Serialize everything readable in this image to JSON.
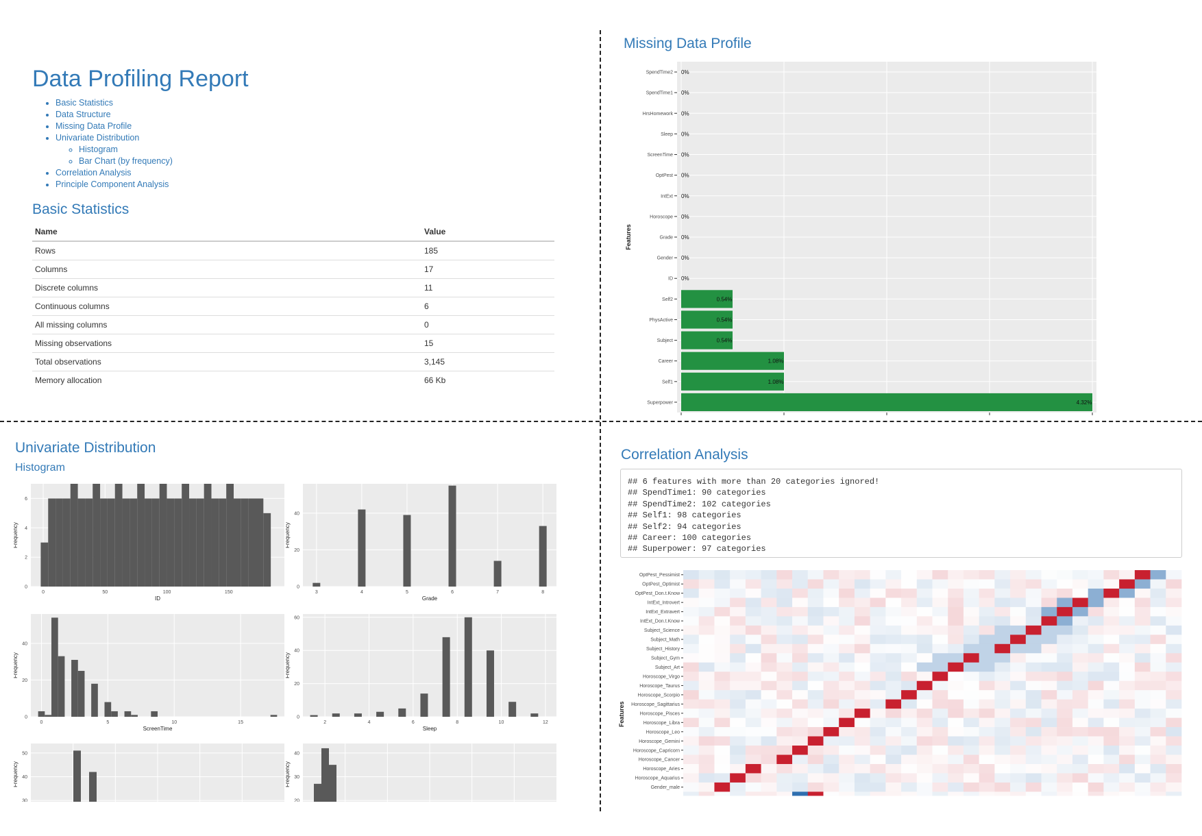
{
  "report": {
    "title": "Data Profiling Report",
    "toc": [
      {
        "label": "Basic Statistics"
      },
      {
        "label": "Data Structure"
      },
      {
        "label": "Missing Data Profile"
      },
      {
        "label": "Univariate Distribution",
        "children": [
          {
            "label": "Histogram"
          },
          {
            "label": "Bar Chart (by frequency)"
          }
        ]
      },
      {
        "label": "Correlation Analysis"
      },
      {
        "label": "Principle Component Analysis"
      }
    ]
  },
  "basic_statistics": {
    "heading": "Basic Statistics",
    "columns": [
      "Name",
      "Value"
    ],
    "rows": [
      [
        "Rows",
        "185"
      ],
      [
        "Columns",
        "17"
      ],
      [
        "Discrete columns",
        "11"
      ],
      [
        "Continuous columns",
        "6"
      ],
      [
        "All missing columns",
        "0"
      ],
      [
        "Missing observations",
        "15"
      ],
      [
        "Total observations",
        "3,145"
      ],
      [
        "Memory allocation",
        "66 Kb"
      ]
    ]
  },
  "missing": {
    "heading": "Missing Data Profile",
    "ylabel": "Features"
  },
  "univariate": {
    "heading": "Univariate Distribution",
    "subheading": "Histogram"
  },
  "correlation": {
    "heading": "Correlation Analysis",
    "ylabel": "Features",
    "console": [
      "## 6 features with more than 20 categories ignored!",
      "## SpendTime1: 90 categories",
      "## SpendTime2: 102 categories",
      "## Self1: 98 categories",
      "## Self2: 94 categories",
      "## Career: 100 categories",
      "## Superpower: 97 categories"
    ]
  },
  "colors": {
    "accent": "#337ab7",
    "bar_green": "#239142",
    "panel_bg": "#ebebeb",
    "hist_bar": "#595959",
    "cor_pos": "#c8202f",
    "cor_neg": "#2f6fb0"
  },
  "chart_data": [
    {
      "type": "bar",
      "orientation": "horizontal",
      "title": "Missing Data Profile",
      "ylabel": "Features",
      "categories": [
        "SpendTime2",
        "SpendTime1",
        "HrsHomework",
        "Sleep",
        "ScreenTime",
        "OptPest",
        "IntExt",
        "Horoscope",
        "Grade",
        "Gender",
        "ID",
        "Self2",
        "PhysActive",
        "Subject",
        "Career",
        "Self1",
        "Superpower"
      ],
      "values": [
        0,
        0,
        0,
        0,
        0,
        0,
        0,
        0,
        0,
        0,
        0,
        0.54,
        0.54,
        0.54,
        1.08,
        1.08,
        4.32
      ],
      "labels": [
        "0%",
        "0%",
        "0%",
        "0%",
        "0%",
        "0%",
        "0%",
        "0%",
        "0%",
        "0%",
        "0%",
        "0.54%",
        "0.54%",
        "0.54%",
        "1.08%",
        "1.08%",
        "4.32%"
      ],
      "xlim": [
        0,
        4.5
      ]
    },
    {
      "type": "bar",
      "title": "",
      "xlabel": "ID",
      "ylabel": "Frequency",
      "x": [
        1,
        7,
        13,
        19,
        25,
        31,
        37,
        43,
        49,
        55,
        61,
        67,
        73,
        79,
        85,
        91,
        97,
        103,
        109,
        115,
        121,
        127,
        133,
        139,
        145,
        151,
        157,
        163,
        169,
        175,
        181
      ],
      "values": [
        3,
        6,
        6,
        6,
        7,
        6,
        6,
        7,
        6,
        6,
        7,
        6,
        6,
        7,
        6,
        6,
        7,
        6,
        6,
        7,
        6,
        6,
        7,
        6,
        6,
        7,
        6,
        6,
        6,
        6,
        5
      ],
      "xticks": [
        0,
        50,
        100,
        150
      ],
      "yticks": [
        0,
        2,
        4,
        6
      ],
      "xlim": [
        -10,
        195
      ],
      "ylim": [
        0,
        7
      ]
    },
    {
      "type": "bar",
      "title": "",
      "xlabel": "Grade",
      "ylabel": "Frequency",
      "x": [
        3,
        4,
        5,
        6,
        7,
        8
      ],
      "values": [
        2,
        42,
        39,
        55,
        14,
        33
      ],
      "xticks": [
        3,
        4,
        5,
        6,
        7,
        8
      ],
      "yticks": [
        0,
        20,
        40
      ],
      "xlim": [
        2.7,
        8.3
      ],
      "ylim": [
        0,
        56
      ]
    },
    {
      "type": "bar",
      "title": "",
      "xlabel": "ScreenTime",
      "ylabel": "Frequency",
      "x": [
        0,
        0.5,
        1,
        1.5,
        2,
        2.5,
        3,
        3.5,
        4,
        4.5,
        5,
        5.5,
        6,
        6.5,
        7,
        7.5,
        8,
        8.5,
        9,
        9.5,
        10,
        17.5
      ],
      "values": [
        3,
        1,
        54,
        33,
        0,
        31,
        25,
        0,
        18,
        0,
        8,
        3,
        0,
        3,
        1,
        0,
        0,
        3,
        0,
        0,
        0,
        1
      ],
      "xticks": [
        0,
        5,
        10,
        15
      ],
      "yticks": [
        0,
        20,
        40
      ],
      "xlim": [
        -0.8,
        18.3
      ],
      "ylim": [
        0,
        56
      ]
    },
    {
      "type": "bar",
      "title": "",
      "xlabel": "Sleep",
      "ylabel": "Frequency",
      "x": [
        1.5,
        2.5,
        3.5,
        4.5,
        5.5,
        6.5,
        7.5,
        8.5,
        9.5,
        10.5,
        11.5,
        12.5
      ],
      "values": [
        1,
        2,
        2,
        3,
        5,
        14,
        48,
        60,
        40,
        9,
        2,
        0
      ],
      "xticks": [
        2,
        4,
        6,
        8,
        10,
        12
      ],
      "yticks": [
        0,
        20,
        40,
        60
      ],
      "xlim": [
        1,
        12.5
      ],
      "ylim": [
        0,
        62
      ]
    },
    {
      "type": "bar",
      "title": "",
      "xlabel": "",
      "ylabel": "Frequency",
      "values": [
        51,
        42
      ],
      "yticks": [
        30,
        40,
        50
      ]
    },
    {
      "type": "bar",
      "title": "",
      "xlabel": "",
      "ylabel": "Frequency",
      "values": [
        27,
        42,
        35
      ],
      "yticks": [
        20,
        30,
        40
      ]
    },
    {
      "type": "heatmap",
      "title": "Correlation Analysis",
      "ylabel": "Features",
      "rows": [
        "OptPest_Pessimist",
        "OptPest_Optimist",
        "OptPest_Don.t.Know",
        "IntExt_Introvert",
        "IntExt_Extravert",
        "IntExt_Don.t.Know",
        "Subject_Science",
        "Subject_Math",
        "Subject_History",
        "Subject_Gym",
        "Subject_Art",
        "Horoscope_Virgo",
        "Horoscope_Taurus",
        "Horoscope_Scorpio",
        "Horoscope_Sagittarius",
        "Horoscope_Pisces",
        "Horoscope_Libra",
        "Horoscope_Leo",
        "Horoscope_Gemini",
        "Horoscope_Capricorn",
        "Horoscope_Cancer",
        "Horoscope_Aries",
        "Horoscope_Aquarius",
        "Gender_male"
      ],
      "range": [
        -1,
        1
      ]
    }
  ]
}
